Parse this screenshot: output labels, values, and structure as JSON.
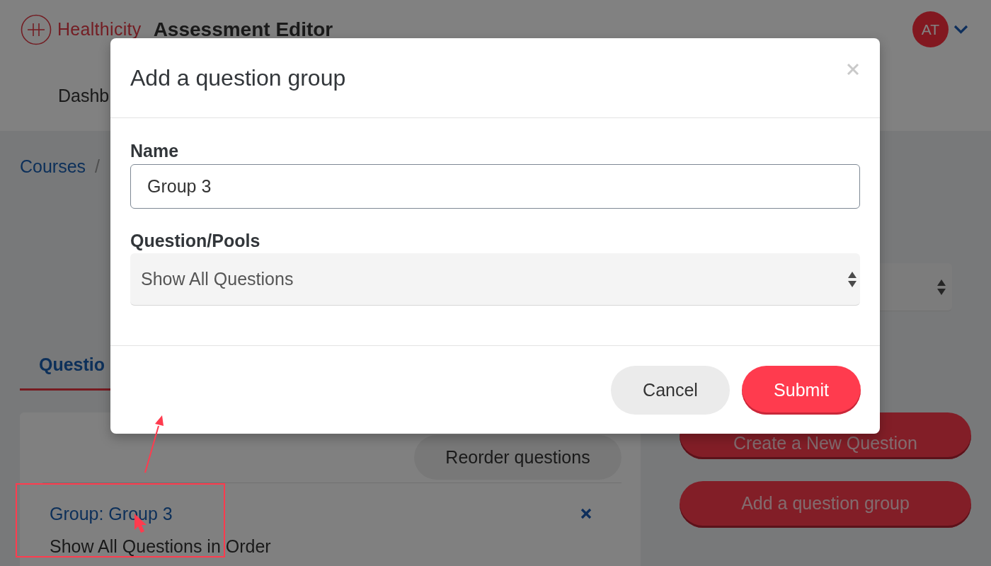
{
  "header": {
    "logo_text": "Healthicity",
    "app_title": "Assessment Editor",
    "user": {
      "initials": "AT"
    }
  },
  "nav": [
    {
      "label": "Dashb"
    }
  ],
  "breadcrumb": {
    "items": [
      "Courses"
    ],
    "separator": "/"
  },
  "tabs": [
    {
      "label": "Questio",
      "selected": true
    }
  ],
  "questions_panel": {
    "reorder_button": "Reorder questions",
    "groups": [
      {
        "title": "Group: Group 3",
        "description": "Show All Questions in Order"
      }
    ]
  },
  "actions": [
    {
      "label": "Create a New Question"
    },
    {
      "label": "Add a question group"
    }
  ],
  "modal": {
    "title": "Add a question group",
    "fields": [
      {
        "kind": "text",
        "label": "Name",
        "value": "Group 3"
      },
      {
        "kind": "select",
        "label": "Question/Pools",
        "value": "Show All Questions"
      }
    ],
    "buttons": [
      {
        "kind": "secondary",
        "label": "Cancel"
      },
      {
        "kind": "primary",
        "label": "Submit"
      }
    ]
  }
}
